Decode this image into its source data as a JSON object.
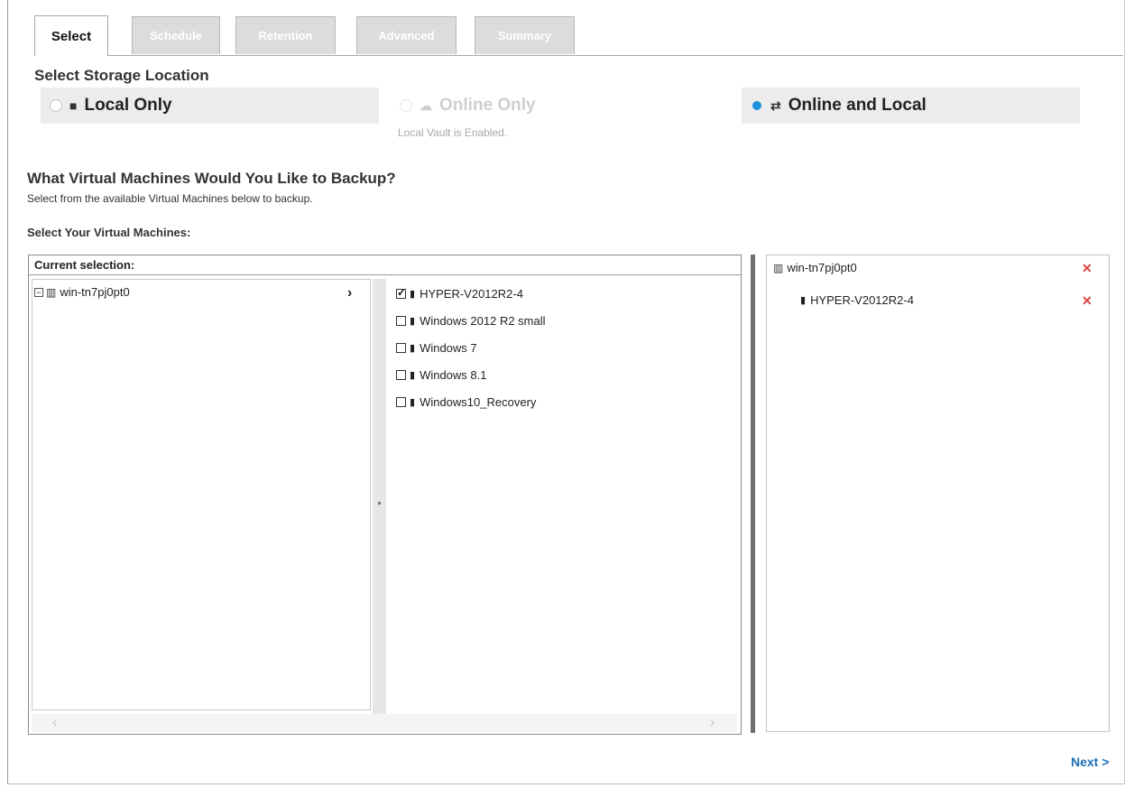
{
  "tabs": [
    {
      "label": "Select",
      "active": true
    },
    {
      "label": "Schedule",
      "active": false
    },
    {
      "label": "Retention",
      "active": false
    },
    {
      "label": "Advanced",
      "active": false
    },
    {
      "label": "Summary",
      "active": false
    }
  ],
  "storage": {
    "title": "Select Storage Location",
    "options": [
      {
        "label": "Local Only",
        "icon": "server-icon",
        "selected": false,
        "disabled": false
      },
      {
        "label": "Online Only",
        "icon": "cloud-icon",
        "selected": false,
        "disabled": true
      },
      {
        "label": "Online and Local",
        "icon": "cloud-server-icon",
        "selected": true,
        "disabled": false
      }
    ],
    "hint": "Local Vault is Enabled."
  },
  "vm_section": {
    "title": "What Virtual Machines Would You Like to Backup?",
    "subtitle": "Select from the available Virtual Machines below to backup.",
    "select_label": "Select Your Virtual Machines:",
    "current_selection_label": "Current selection:",
    "host": "win-tn7pj0pt0",
    "vms": [
      {
        "name": "HYPER-V2012R2-4",
        "checked": true
      },
      {
        "name": "Windows 2012 R2 small",
        "checked": false
      },
      {
        "name": "Windows 7",
        "checked": false
      },
      {
        "name": "Windows 8.1",
        "checked": false
      },
      {
        "name": "Windows10_Recovery",
        "checked": false
      }
    ]
  },
  "selected_panel": {
    "host": "win-tn7pj0pt0",
    "vm": "HYPER-V2012R2-4",
    "remove_symbol": "✕"
  },
  "footer": {
    "next_label": "Next >"
  },
  "colors": {
    "accent": "#1f8fdc",
    "remove": "#e04040",
    "link": "#1b6fb5"
  }
}
